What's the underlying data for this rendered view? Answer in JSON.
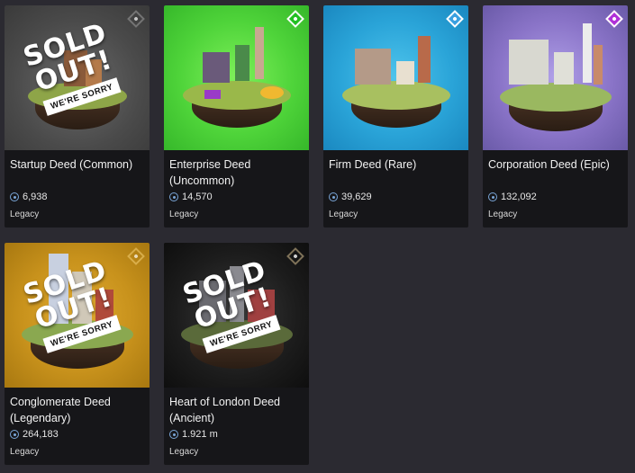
{
  "cards": [
    {
      "title": "Startup Deed (Common)",
      "price": "6,938",
      "edition": "Legacy",
      "rarity_color": "#8a8a8a",
      "bg": "#5a5a5a",
      "sold_out": true
    },
    {
      "title": "Enterprise Deed (Uncommon)",
      "price": "14,570",
      "edition": "Legacy",
      "rarity_color": "#3ddc3d",
      "bg": "#4fd43a",
      "sold_out": false
    },
    {
      "title": "Firm Deed (Rare)",
      "price": "39,629",
      "edition": "Legacy",
      "rarity_color": "#4fb6ea",
      "bg": "#2aa4d8",
      "sold_out": false
    },
    {
      "title": "Corporation Deed (Epic)",
      "price": "132,092",
      "edition": "Legacy",
      "rarity_color": "#d04cf0",
      "bg": "#8a74c8",
      "sold_out": false
    },
    {
      "title": "Conglomerate Deed (Legendary)",
      "price": "264,183",
      "edition": "Legacy",
      "rarity_color": "#c89a2a",
      "bg": "#c8921c",
      "sold_out": true
    },
    {
      "title": "Heart of London Deed (Ancient)",
      "price": "1.921 m",
      "edition": "Legacy",
      "rarity_color": "#9a8a6a",
      "bg": "#1c1c1c",
      "sold_out": true
    }
  ],
  "sold_out_text": {
    "line1": "SOLD",
    "line2": "OUT!",
    "tag": "WE'RE SORRY"
  }
}
